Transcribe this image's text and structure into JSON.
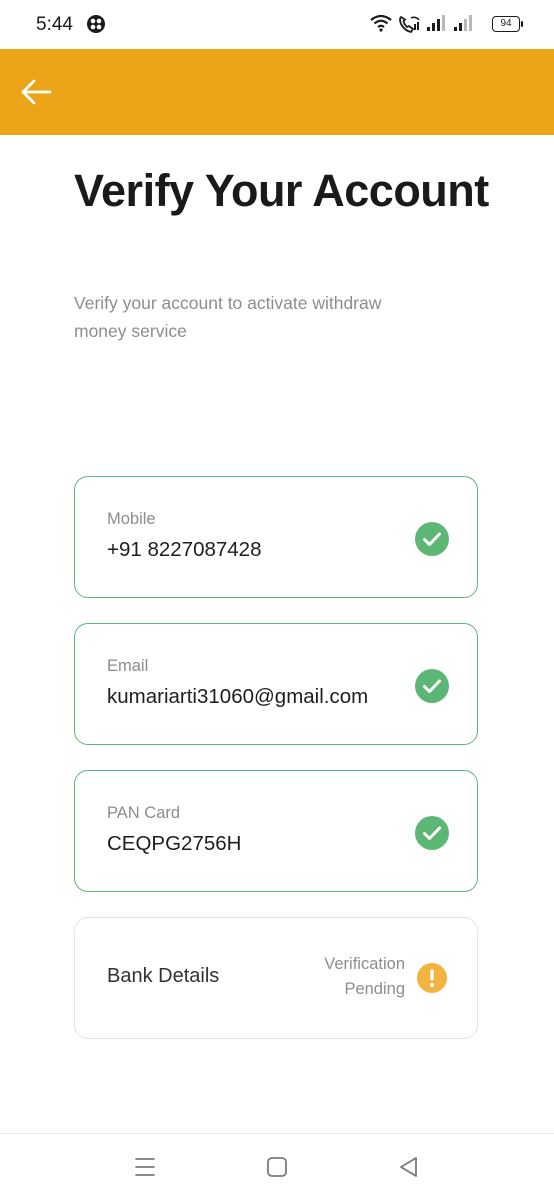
{
  "status_bar": {
    "time": "5:44",
    "battery": "94",
    "icons": [
      "app-notification-icon",
      "wifi-icon",
      "wifi-call-icon",
      "signal-1-icon",
      "signal-2-icon",
      "battery-icon"
    ]
  },
  "app_bar": {
    "color": "#ECA518",
    "back_icon": "arrow-left-icon"
  },
  "header": {
    "title": "Verify Your Account",
    "subtitle": "Verify your account to activate withdraw money service"
  },
  "verification_items": [
    {
      "label": "Mobile",
      "value": "+91 8227087428",
      "status": "verified",
      "icon": "check-circle-icon"
    },
    {
      "label": "Email",
      "value": "kumariarti31060@gmail.com",
      "status": "verified",
      "icon": "check-circle-icon"
    },
    {
      "label": "PAN Card",
      "value": "CEQPG2756H",
      "status": "verified",
      "icon": "check-circle-icon"
    }
  ],
  "bank_details": {
    "label": "Bank Details",
    "status_text": "Verification Pending",
    "icon": "warning-icon"
  },
  "colors": {
    "verified": "#5CB775",
    "pending": "#F2B440",
    "accent": "#ECA518"
  },
  "nav_bar": {
    "icons": [
      "menu-icon",
      "home-square-icon",
      "back-triangle-icon"
    ]
  }
}
